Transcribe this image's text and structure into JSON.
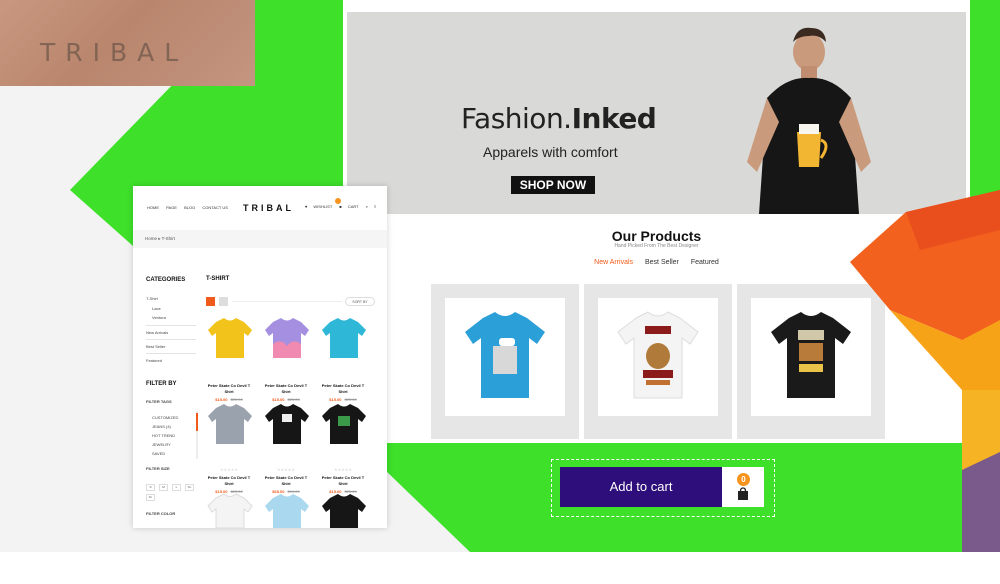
{
  "brand": {
    "logo_patch": "TRIBAL"
  },
  "hero": {
    "title_light": "Fashion.",
    "title_bold": "Inked",
    "subtitle": "Apparels with comfort",
    "cta": "SHOP NOW"
  },
  "products_section": {
    "title": "Our Products",
    "subtitle": "Hand Picked From The Best Designer",
    "tabs": [
      "New Arrivals",
      "Best Seller",
      "Featured"
    ]
  },
  "add_to_cart": {
    "label": "Add to cart",
    "count": "0"
  },
  "shop": {
    "nav": [
      "HOME",
      "PAGE",
      "BLOG",
      "CONTACT US"
    ],
    "logo": "TRIBAL",
    "header_icons": [
      "WISHLIST",
      "CART"
    ],
    "breadcrumb": "Home  ▸  T-Shirt",
    "categories_title": "CATEGORIES",
    "category_items": [
      "T-Shirt",
      "Lace",
      "Ventura",
      "New Arrivals",
      "Best Seller",
      "Featured"
    ],
    "filter_title": "FILTER BY",
    "filter_tags_title": "FILTER TAGS",
    "filter_tags": [
      "CUSTOMIZED",
      "JEANS (4)",
      "HOT TREND",
      "JEWELRY",
      "SAVED"
    ],
    "filter_size_title": "FILTER SIZE",
    "sizes": [
      "S",
      "M",
      "L",
      "XL",
      "XL"
    ],
    "filter_color_title": "FILTER COLOR",
    "section_title": "T-SHIRT",
    "sort_label": "SORT BY",
    "products": [
      {
        "name": "Peter Skate Co Devil T Shirt",
        "price": "$15.00",
        "old": "$25.00"
      },
      {
        "name": "Peter Skate Co Devil T Shirt",
        "price": "$15.00",
        "old": "$25.00"
      },
      {
        "name": "Peter Skate Co Devil T Shirt",
        "price": "$15.00",
        "old": "$25.00"
      },
      {
        "name": "Peter Skate Co Devil T Shirt",
        "price": "$15.00",
        "old": "$25.00"
      },
      {
        "name": "Peter Skate Co Devil T Shirt",
        "price": "$65.00",
        "old": "$15.00"
      },
      {
        "name": "Peter Skate Co Devil T Shirt",
        "price": "$15.00",
        "old": "$25.00"
      }
    ]
  },
  "colors": {
    "green": "#3ee02a",
    "cart_button": "#2d0e7a",
    "accent_orange": "#f05a1a",
    "badge": "#f7941d"
  }
}
